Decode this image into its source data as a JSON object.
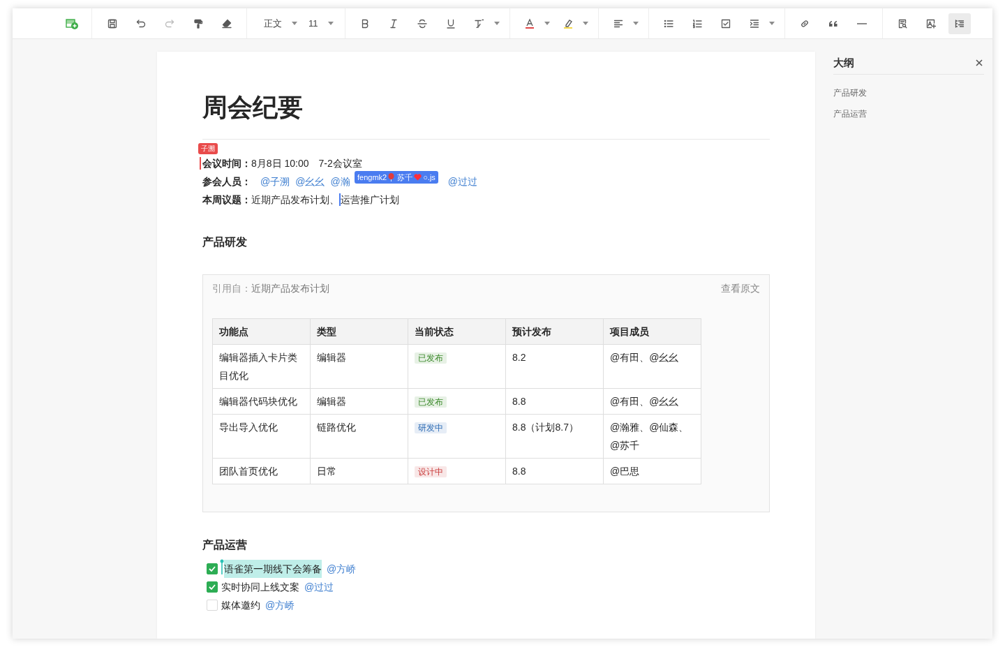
{
  "toolbar": {
    "style_value": "正文",
    "size_value": "11",
    "redo_disabled": true,
    "outline_on": true
  },
  "document": {
    "title": "周会纪要",
    "cursor_top": {
      "name": "子溯",
      "color": "#e94b4b"
    },
    "meta": [
      {
        "label": "会议时间：",
        "value": "8月8日 10:00　7-2会议室"
      },
      {
        "label": "参会人员：",
        "mentions_before": [
          "@子溯",
          "@幺幺",
          "@瀚"
        ],
        "mentions_after": [
          "@过过"
        ]
      },
      {
        "label": "本周议题：",
        "value": "近期产品发布计划、",
        "value_after": "运营推广计划"
      }
    ],
    "cursor_mid": {
      "prefix": "fengmk2",
      "name": "苏千",
      "suffix": "○.js",
      "color": "#4a7cf0"
    },
    "sections": [
      {
        "heading": "产品研发",
        "quote": {
          "source_label": "引用自：",
          "source": "近期产品发布计划",
          "view_link": "查看原文",
          "table": {
            "columns": [
              "功能点",
              "类型",
              "当前状态",
              "预计发布",
              "项目成员"
            ],
            "rows": [
              {
                "feature": "编辑器插入卡片类目优化",
                "type": "编辑器",
                "status": {
                  "text": "已发布",
                  "color": "#3d8a2c"
                },
                "release": "8.2",
                "members": "@有田、@幺幺"
              },
              {
                "feature": "编辑器代码块优化",
                "type": "编辑器",
                "status": {
                  "text": "已发布",
                  "color": "#3d8a2c"
                },
                "release": "8.8",
                "members": "@有田、@幺幺"
              },
              {
                "feature": "导出导入优化",
                "type": "链路优化",
                "status": {
                  "text": "研发中",
                  "color": "#2f6db5"
                },
                "release": "8.8（计划8.7）",
                "members": "@瀚雅、@仙森、@苏千"
              },
              {
                "feature": "团队首页优化",
                "type": "日常",
                "status": {
                  "text": "设计中",
                  "color": "#c93a3a"
                },
                "release": "8.8",
                "members": "@巴思"
              }
            ]
          }
        }
      },
      {
        "heading": "产品运营",
        "tasks": [
          {
            "text": "语雀第一期线下会筹备",
            "mention": "@方峤",
            "checked": true,
            "highlighted": true
          },
          {
            "text": "实时协同上线文案",
            "mention": "@过过",
            "checked": true,
            "highlighted": false
          },
          {
            "text": "媒体邀约",
            "mention": "@方峤",
            "checked": false,
            "highlighted": false
          }
        ]
      }
    ]
  },
  "outline": {
    "title": "大纲",
    "items": [
      "产品研发",
      "产品运营"
    ]
  }
}
